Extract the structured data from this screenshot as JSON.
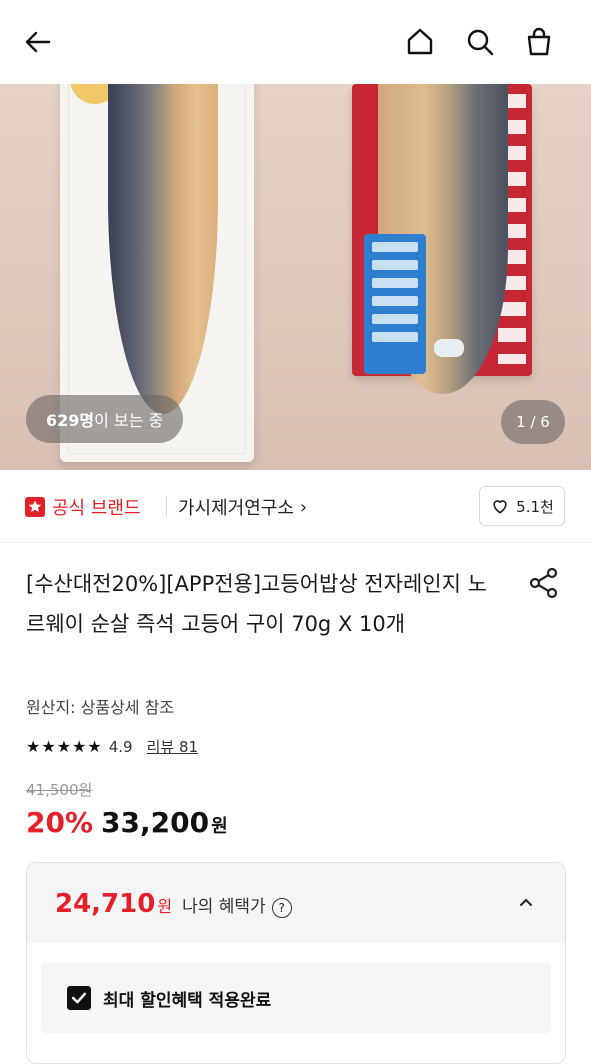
{
  "header": {
    "back": "back-arrow-icon",
    "home": "home-icon",
    "search": "search-icon",
    "cart": "shopping-bag-icon"
  },
  "gallery": {
    "viewers_count": "629명",
    "viewers_suffix": "이 보는 중",
    "page": "1 / 6"
  },
  "brand": {
    "official_label": "공식 브랜드",
    "store_name": "가시제거연구소",
    "store_chevron": "›",
    "likes": "5.1천"
  },
  "product": {
    "title": "[수산대전20%][APP전용]고등어밥상 전자레인지 노르웨이 순살 즉석 고등어 구이 70g X 10개",
    "origin": "원산지: 상품상세 참조",
    "stars": "★★★★★",
    "rating": "4.9",
    "review": "리뷰 81",
    "original_price": "41,500원",
    "discount": "20%",
    "price": "33,200",
    "currency": "원"
  },
  "benefit": {
    "price": "24,710",
    "currency": "원",
    "label": "나의 혜택가",
    "help": "?",
    "check_label": "최대 할인혜택 적용완료"
  },
  "colors": {
    "accent": "#e4202b",
    "text": "#222222"
  }
}
